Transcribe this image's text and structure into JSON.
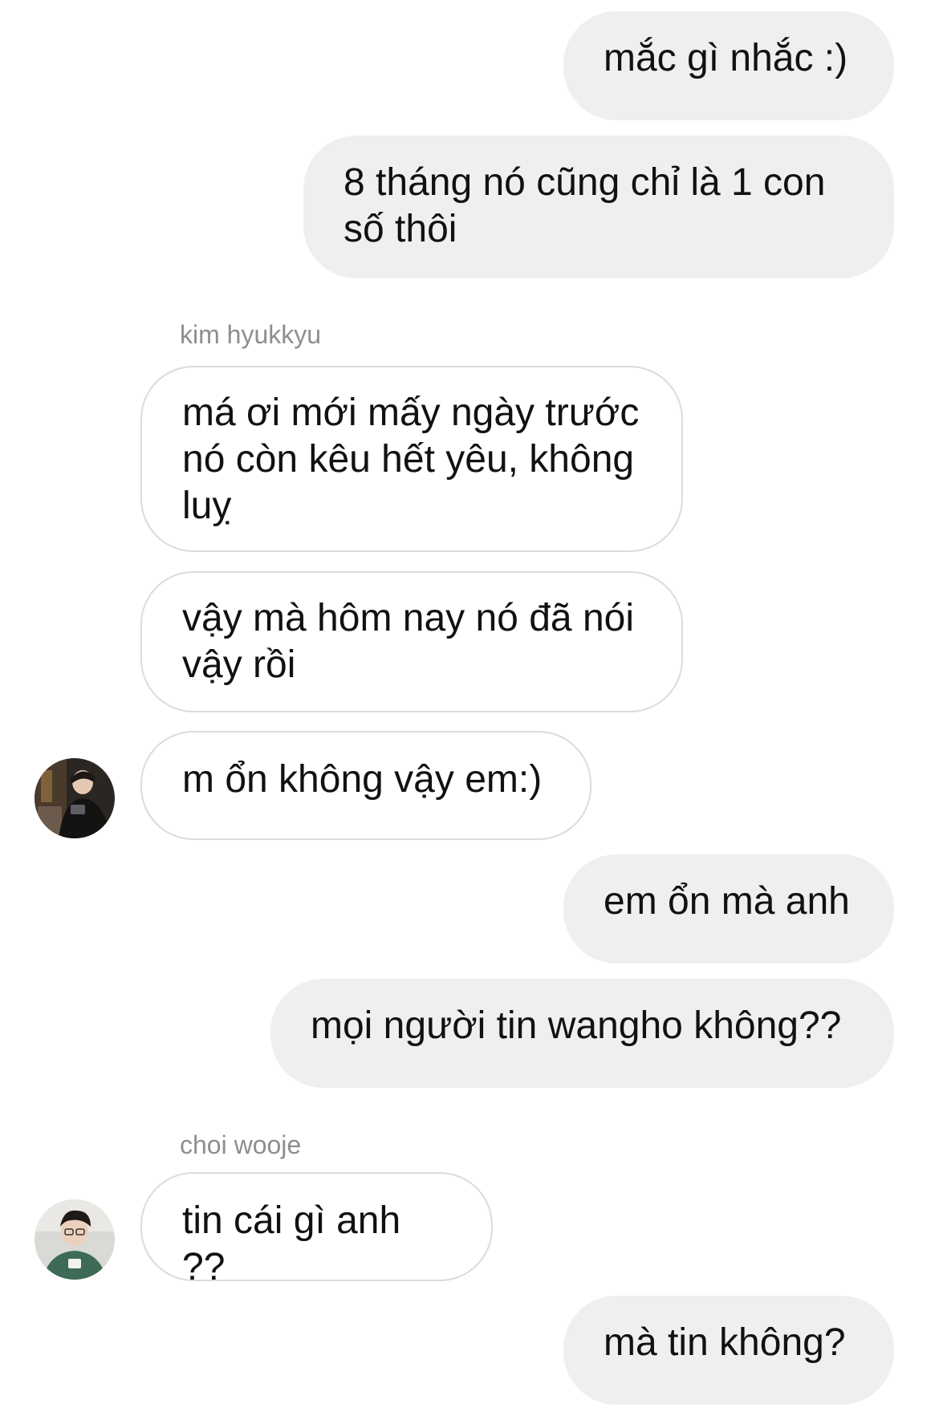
{
  "messages": [
    {
      "type": "outgoing",
      "text": "mắc gì nhắc :)"
    },
    {
      "type": "outgoing",
      "text": "8 tháng nó cũng chỉ là 1 con số thôi"
    },
    {
      "type": "sender",
      "text": "kim hyukkyu"
    },
    {
      "type": "incoming",
      "text": "má ơi mới mấy ngày trước nó còn kêu hết yêu, không luỵ"
    },
    {
      "type": "incoming",
      "text": "vậy mà hôm nay nó đã nói vậy rồi"
    },
    {
      "type": "incoming",
      "text": "m ổn không vậy em:)",
      "avatar": "avatar-kim-hyukkyu"
    },
    {
      "type": "outgoing",
      "text": "em ổn mà anh"
    },
    {
      "type": "outgoing",
      "text": "mọi người tin wangho không??"
    },
    {
      "type": "sender",
      "text": "choi wooje"
    },
    {
      "type": "incoming",
      "text": "tin cái gì anh ??",
      "avatar": "avatar-choi-wooje"
    },
    {
      "type": "outgoing",
      "text": "mà tin không?"
    }
  ],
  "colors": {
    "outgoing_bubble": "#efefef",
    "incoming_border": "#dbdbdb",
    "sender_name": "#8e8e8e",
    "text": "#111111"
  }
}
